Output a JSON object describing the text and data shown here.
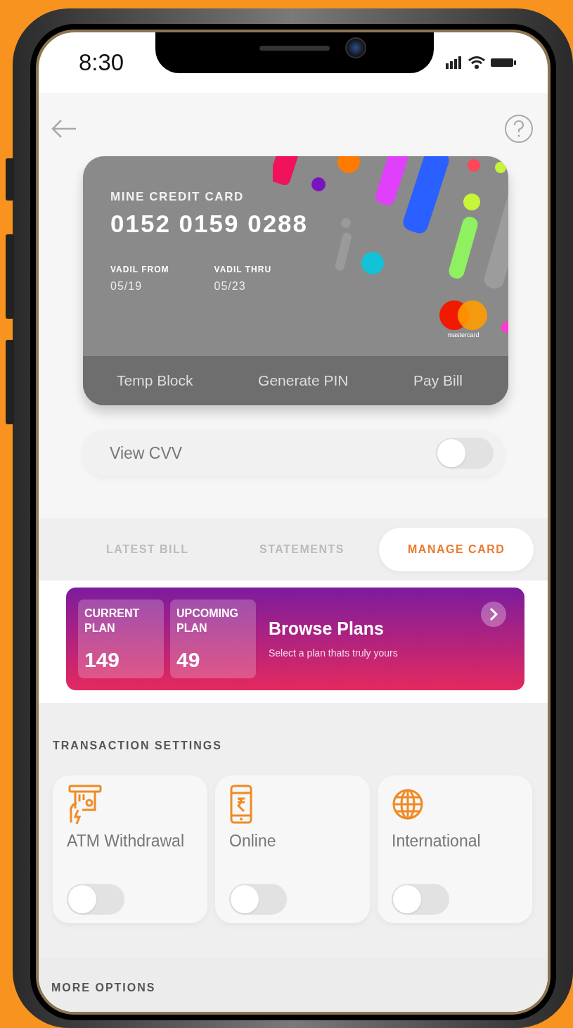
{
  "status_bar": {
    "time": "8:30"
  },
  "card": {
    "title": "MINE CREDIT CARD",
    "number": "0152 0159 0288",
    "dates": [
      {
        "label": "VADIL FROM",
        "value": "05/19"
      },
      {
        "label": "VADIL THRU",
        "value": "05/23"
      }
    ],
    "brand": "mastercard",
    "actions": [
      "Temp Block",
      "Generate PIN",
      "Pay Bill"
    ]
  },
  "cvv": {
    "label": "View CVV",
    "on": false
  },
  "tabs": [
    {
      "label": "LATEST BILL",
      "selected": false
    },
    {
      "label": "STATEMENTS",
      "selected": false
    },
    {
      "label": "MANAGE CARD",
      "selected": true
    }
  ],
  "plans": {
    "boxes": [
      {
        "label": "CURRENT PLAN",
        "value": "149"
      },
      {
        "label": "UPCOMING PLAN",
        "value": "49"
      }
    ],
    "title": "Browse Plans",
    "subtitle": "Select a plan thats truly yours"
  },
  "transaction_settings": {
    "heading": "TRANSACTION SETTINGS",
    "items": [
      {
        "kind": "atm",
        "label": "ATM Withdrawal",
        "on": false
      },
      {
        "kind": "online",
        "label": "Online",
        "on": false
      },
      {
        "kind": "international",
        "label": "International",
        "on": false
      }
    ]
  },
  "more_options": {
    "heading": "MORE OPTIONS"
  }
}
